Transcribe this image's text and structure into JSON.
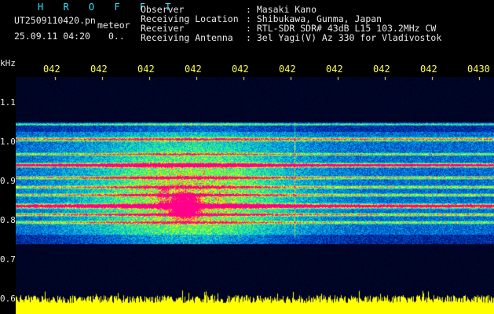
{
  "header": {
    "title": "H R O F F T",
    "filename": "UT2509110420.pn",
    "suffix": "meteor",
    "datetime": "25.09.11 04:20",
    "extra": "0..",
    "fields": [
      {
        "label": "Observer",
        "value": ": Masaki Kano"
      },
      {
        "label": "Receiving Location",
        "value": ": Shibukawa, Gunma, Japan"
      },
      {
        "label": "Receiver",
        "value": ": RTL-SDR SDR# 43dB L15 103.2MHz CW"
      },
      {
        "label": "Receiving Antenna",
        "value": ": 3el Yagi(V) Az 330 for Vladivostok"
      }
    ]
  },
  "axis": {
    "unit": "kHz",
    "y_ticks": [
      "1.1",
      "1.0",
      "0.9",
      "0.8",
      "0.7",
      "0.6"
    ],
    "x_ticks": [
      "042",
      "042",
      "042",
      "042",
      "042",
      "042",
      "042",
      "042",
      "042",
      "0430"
    ]
  },
  "colors": {
    "background": "#000000",
    "text_cyan": "#33e0ff",
    "text_white": "#e8e8e8",
    "text_yellow": "#ffff40"
  }
}
